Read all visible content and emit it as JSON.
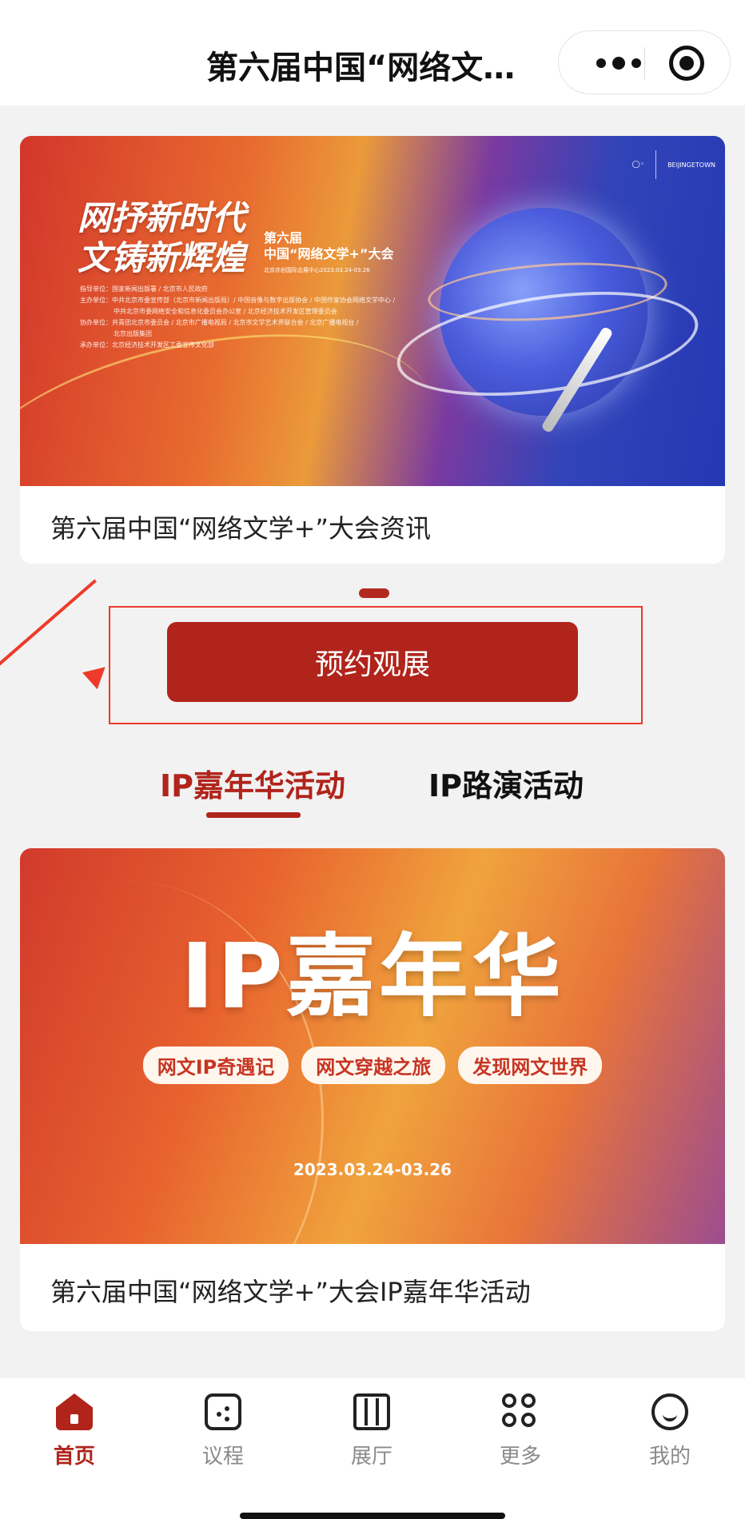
{
  "header": {
    "title": "第六届中国“网络文…"
  },
  "news_card": {
    "banner": {
      "slogan_line1": "网抒新时代",
      "slogan_line2": "文铸新辉煌",
      "edition": "第六届",
      "conference": "中国“网络文学+”大会",
      "venue": "北京亦创国际会展中心2023.03.24-03.26",
      "org_line1": "指导单位：国家新闻出版署 / 北京市人民政府",
      "org_line2": "主办单位：中共北京市委宣传部（北京市新闻出版局）/ 中国音像与数字出版协会 / 中国作家协会网络文学中心 /",
      "org_line3": "中共北京市委网络安全和信息化委员会办公室 / 北京经济技术开发区管理委员会",
      "org_line4": "协办单位：共青团北京市委员会 / 北京市广播电视局 / 北京市文学艺术界联合会 / 北京广播电视台 /",
      "org_line5": "北京出版集团",
      "org_line6": "承办单位：北京经济技术开发区工委宣传文化部",
      "logo_right": "BEIJINGETOWN"
    },
    "caption": "第六届中国“网络文学+”大会资讯"
  },
  "reserve_button": {
    "label": "预约观展"
  },
  "tabs": [
    {
      "label": "IP嘉年华活动",
      "active": true
    },
    {
      "label": "IP路演活动",
      "active": false
    }
  ],
  "carnival_card": {
    "banner": {
      "title": "IP嘉年华",
      "pills": [
        "网文IP奇遇记",
        "网文穿越之旅",
        "发现网文世界"
      ],
      "date": "2023.03.24-03.26"
    },
    "caption": "第六届中国“网络文学+”大会IP嘉年华活动"
  },
  "bottom_nav": {
    "items": [
      {
        "label": "首页",
        "icon": "home-icon",
        "active": true
      },
      {
        "label": "议程",
        "icon": "agenda-icon",
        "active": false
      },
      {
        "label": "展厅",
        "icon": "hall-icon",
        "active": false
      },
      {
        "label": "更多",
        "icon": "more-grid-icon",
        "active": false
      },
      {
        "label": "我的",
        "icon": "profile-icon",
        "active": false
      }
    ]
  },
  "colors": {
    "accent": "#b0241b",
    "annotation_red": "#ee3a2a",
    "background": "#f2f2f2"
  }
}
